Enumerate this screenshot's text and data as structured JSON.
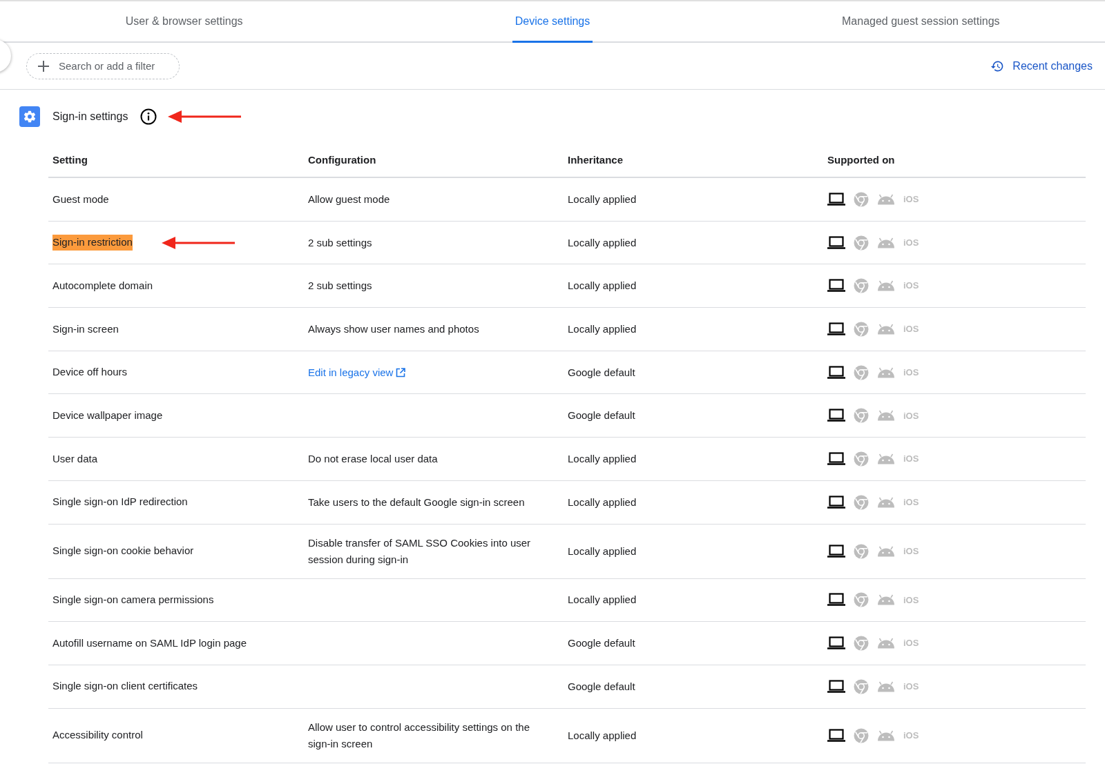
{
  "tabs": [
    {
      "label": "User & browser settings",
      "selected": false
    },
    {
      "label": "Device settings",
      "selected": true
    },
    {
      "label": "Managed guest session settings",
      "selected": false
    }
  ],
  "filter": {
    "placeholder": "Search or add a filter"
  },
  "recent_changes": "Recent changes",
  "section": {
    "title": "Sign-in settings",
    "arrow": true
  },
  "table": {
    "columns": [
      "Setting",
      "Configuration",
      "Inheritance",
      "Supported on"
    ],
    "rows": [
      {
        "setting": "Guest mode",
        "configuration": "Allow guest mode",
        "link": false,
        "inheritance": "Locally applied",
        "highlighted": false,
        "arrow": false,
        "platforms": [
          {
            "kind": "laptop",
            "supported": true
          },
          {
            "kind": "chrome",
            "supported": false
          },
          {
            "kind": "android",
            "supported": false
          },
          {
            "kind": "ios",
            "label": "iOS",
            "supported": false
          }
        ]
      },
      {
        "setting": "Sign-in restriction",
        "configuration": "2 sub settings",
        "link": false,
        "inheritance": "Locally applied",
        "highlighted": true,
        "arrow": true,
        "platforms": [
          {
            "kind": "laptop",
            "supported": true
          },
          {
            "kind": "chrome",
            "supported": false
          },
          {
            "kind": "android",
            "supported": false
          },
          {
            "kind": "ios",
            "label": "iOS",
            "supported": false
          }
        ]
      },
      {
        "setting": "Autocomplete domain",
        "configuration": "2 sub settings",
        "link": false,
        "inheritance": "Locally applied",
        "highlighted": false,
        "arrow": false,
        "platforms": [
          {
            "kind": "laptop",
            "supported": true
          },
          {
            "kind": "chrome",
            "supported": false
          },
          {
            "kind": "android",
            "supported": false
          },
          {
            "kind": "ios",
            "label": "iOS",
            "supported": false
          }
        ]
      },
      {
        "setting": "Sign-in screen",
        "configuration": "Always show user names and photos",
        "link": false,
        "inheritance": "Locally applied",
        "highlighted": false,
        "arrow": false,
        "platforms": [
          {
            "kind": "laptop",
            "supported": true
          },
          {
            "kind": "chrome",
            "supported": false
          },
          {
            "kind": "android",
            "supported": false
          },
          {
            "kind": "ios",
            "label": "iOS",
            "supported": false
          }
        ]
      },
      {
        "setting": "Device off hours",
        "configuration": "Edit in legacy view",
        "link": true,
        "inheritance": "Google default",
        "highlighted": false,
        "arrow": false,
        "platforms": [
          {
            "kind": "laptop",
            "supported": true
          },
          {
            "kind": "chrome",
            "supported": false
          },
          {
            "kind": "android",
            "supported": false
          },
          {
            "kind": "ios",
            "label": "iOS",
            "supported": false
          }
        ]
      },
      {
        "setting": "Device wallpaper image",
        "inheritance": "Google default",
        "highlighted": false,
        "arrow": false,
        "platforms": [
          {
            "kind": "laptop",
            "supported": true
          },
          {
            "kind": "chrome",
            "supported": false
          },
          {
            "kind": "android",
            "supported": false
          },
          {
            "kind": "ios",
            "label": "iOS",
            "supported": false
          }
        ]
      },
      {
        "setting": "User data",
        "configuration": "Do not erase local user data",
        "link": false,
        "inheritance": "Locally applied",
        "highlighted": false,
        "arrow": false,
        "platforms": [
          {
            "kind": "laptop",
            "supported": true
          },
          {
            "kind": "chrome",
            "supported": false
          },
          {
            "kind": "android",
            "supported": false
          },
          {
            "kind": "ios",
            "label": "iOS",
            "supported": false
          }
        ]
      },
      {
        "setting": "Single sign-on IdP redirection",
        "configuration": "Take users to the default Google sign-in screen",
        "link": false,
        "inheritance": "Locally applied",
        "highlighted": false,
        "arrow": false,
        "platforms": [
          {
            "kind": "laptop",
            "supported": true
          },
          {
            "kind": "chrome",
            "supported": false
          },
          {
            "kind": "android",
            "supported": false
          },
          {
            "kind": "ios",
            "label": "iOS",
            "supported": false
          }
        ]
      },
      {
        "setting": "Single sign-on cookie behavior",
        "configuration": "Disable transfer of SAML SSO Cookies into user session during sign-in",
        "link": false,
        "inheritance": "Locally applied",
        "highlighted": false,
        "arrow": false,
        "platforms": [
          {
            "kind": "laptop",
            "supported": true
          },
          {
            "kind": "chrome",
            "supported": false
          },
          {
            "kind": "android",
            "supported": false
          },
          {
            "kind": "ios",
            "label": "iOS",
            "supported": false
          }
        ]
      },
      {
        "setting": "Single sign-on camera permissions",
        "inheritance": "Locally applied",
        "highlighted": false,
        "arrow": false,
        "platforms": [
          {
            "kind": "laptop",
            "supported": true
          },
          {
            "kind": "chrome",
            "supported": false
          },
          {
            "kind": "android",
            "supported": false
          },
          {
            "kind": "ios",
            "label": "iOS",
            "supported": false
          }
        ]
      },
      {
        "setting": "Autofill username on SAML IdP login page",
        "inheritance": "Google default",
        "highlighted": false,
        "arrow": false,
        "platforms": [
          {
            "kind": "laptop",
            "supported": true
          },
          {
            "kind": "chrome",
            "supported": false
          },
          {
            "kind": "android",
            "supported": false
          },
          {
            "kind": "ios",
            "label": "iOS",
            "supported": false
          }
        ]
      },
      {
        "setting": "Single sign-on client certificates",
        "inheritance": "Google default",
        "highlighted": false,
        "arrow": false,
        "platforms": [
          {
            "kind": "laptop",
            "supported": true
          },
          {
            "kind": "chrome",
            "supported": false
          },
          {
            "kind": "android",
            "supported": false
          },
          {
            "kind": "ios",
            "label": "iOS",
            "supported": false
          }
        ]
      },
      {
        "setting": "Accessibility control",
        "configuration": "Allow user to control accessibility settings on the sign-in screen",
        "link": false,
        "inheritance": "Locally applied",
        "highlighted": false,
        "arrow": false,
        "platforms": [
          {
            "kind": "laptop",
            "supported": true
          },
          {
            "kind": "chrome",
            "supported": false
          },
          {
            "kind": "android",
            "supported": false
          },
          {
            "kind": "ios",
            "label": "iOS",
            "supported": false
          }
        ]
      }
    ]
  }
}
